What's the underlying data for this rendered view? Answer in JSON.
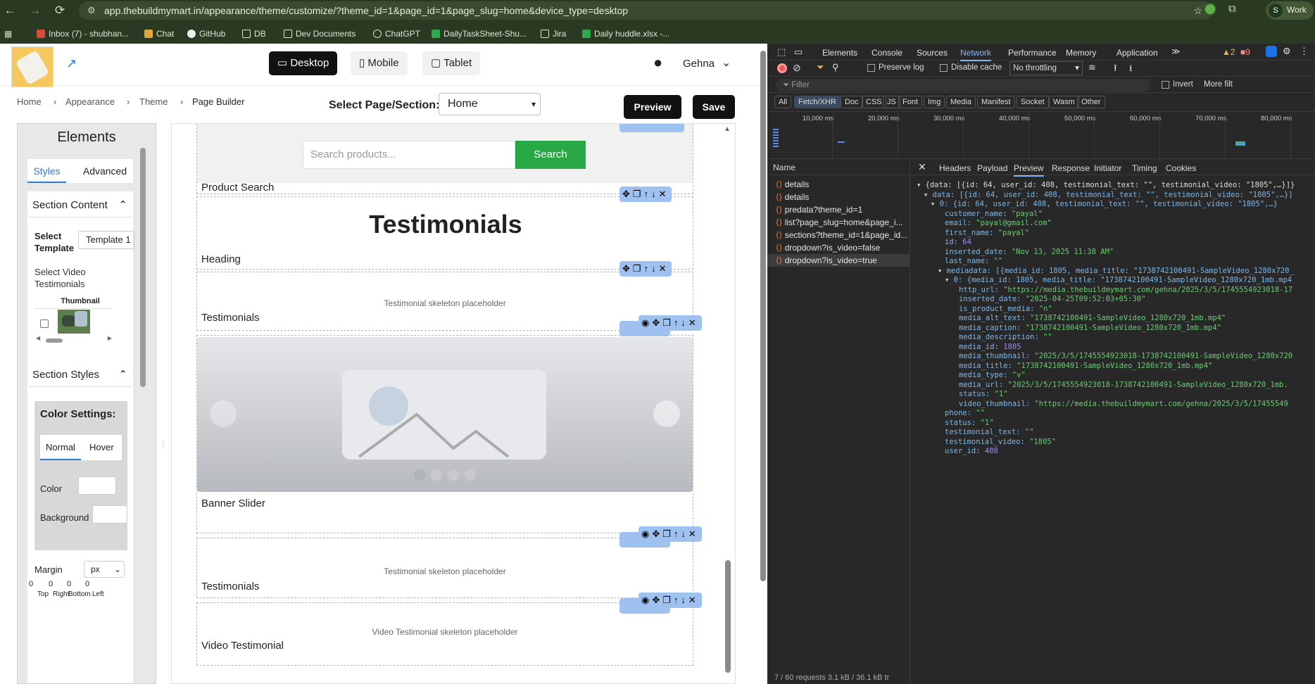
{
  "browser": {
    "url": "app.thebuildmymart.in/appearance/theme/customize/?theme_id=1&page_id=1&page_slug=home&device_type=desktop",
    "profile_initial": "S",
    "profile_label": "Work",
    "bookmarks": [
      "Inbox (7) - shubhan...",
      "Chat",
      "GitHub",
      "DB",
      "Dev Documents",
      "ChatGPT",
      "DailyTaskSheet-Shu...",
      "Jira",
      "Daily huddle.xlsx -..."
    ]
  },
  "app": {
    "devices": [
      "Desktop",
      "Mobile",
      "Tablet"
    ],
    "active_device": "Desktop",
    "user_name": "Gehna",
    "breadcrumb": [
      "Home",
      "Appearance",
      "Theme",
      "Page Builder"
    ],
    "select_page_label": "Select Page/Section:",
    "select_page_value": "Home",
    "preview_label": "Preview",
    "save_label": "Save"
  },
  "sidebar": {
    "title": "Elements",
    "tabs": [
      "Styles",
      "Advanced"
    ],
    "section_content": "Section Content",
    "select_template_label": "Select Template",
    "template_value": "Template 1",
    "select_video_label": "Select Video Testimonials",
    "thumbnail_header": "Thumbnail",
    "section_styles": "Section Styles",
    "color_settings": "Color Settings:",
    "state_tabs": [
      "Normal",
      "Hover"
    ],
    "color_label": "Color",
    "background_label": "Background",
    "margin_label": "Margin",
    "margin_unit": "px",
    "margin_values": [
      "0",
      "0",
      "0",
      "0"
    ],
    "margin_sides": [
      "Top",
      "Right",
      "Bottom",
      "Left"
    ]
  },
  "canvas": {
    "search_placeholder": "Search products...",
    "search_button": "Search",
    "sections": [
      {
        "label": "Product Search"
      },
      {
        "label": "Heading",
        "heading_text": "Testimonials"
      },
      {
        "label": "Testimonials",
        "placeholder": "Testimonial skeleton placeholder"
      },
      {
        "label": "Banner Slider"
      },
      {
        "label": "Testimonials",
        "placeholder": "Testimonial skeleton placeholder"
      },
      {
        "label": "Video Testimonial",
        "placeholder": "Video Testimonial skeleton placeholder"
      }
    ]
  },
  "devtools": {
    "tabs": [
      "Elements",
      "Console",
      "Sources",
      "Network",
      "Performance",
      "Memory",
      "Application"
    ],
    "active_tab": "Network",
    "warn_count": "2",
    "error_count": "9",
    "preserve_log": "Preserve log",
    "disable_cache": "Disable cache",
    "throttling": "No throttling",
    "filter_placeholder": "Filter",
    "invert": "Invert",
    "more_filters": "More filt",
    "type_filters": [
      "All",
      "Fetch/XHR",
      "Doc",
      "CSS",
      "JS",
      "Font",
      "Img",
      "Media",
      "Manifest",
      "Socket",
      "Wasm",
      "Other"
    ],
    "timeline_ticks": [
      "10,000 ms",
      "20,000 ms",
      "30,000 ms",
      "40,000 ms",
      "50,000 ms",
      "60,000 ms",
      "70,000 ms",
      "80,000 ms"
    ],
    "name_header": "Name",
    "requests": [
      "details",
      "details",
      "predata?theme_id=1",
      "list?page_slug=home&page_i...",
      "sections?theme_id=1&page_id...",
      "dropdown?is_video=false",
      "dropdown?is_video=true"
    ],
    "detail_tabs": [
      "Headers",
      "Payload",
      "Preview",
      "Response",
      "Initiator",
      "Timing",
      "Cookies"
    ],
    "active_detail_tab": "Preview",
    "status_bar": "7 / 60 requests   3.1 kB / 36.1 kB tr",
    "json_lines": [
      "{data: [{id: 64, user_id: 408, testimonial_text: \"\", testimonial_video: \"1805\",…}]}",
      "data: [{id: 64, user_id: 408, testimonial_text: \"\", testimonial_video: \"1805\",…}]",
      "0: {id: 64, user_id: 408, testimonial_text: \"\", testimonial_video: \"1805\",…}",
      "customer_name: \"payal\"",
      "email: \"payal@gmail.com\"",
      "first_name: \"payal\"",
      "id: 64",
      "inserted_date: \"Nov 13, 2025 11:38 AM\"",
      "last_name: \"\"",
      "mediadata: [{media_id: 1805, media_title: \"1738742100491-SampleVideo_1280x720_",
      "0: {media_id: 1805, media_title: \"1738742100491-SampleVideo_1280x720_1mb.mp4",
      "http_url: \"https://media.thebuildmymart.com/gehna/2025/3/5/1745554923018-17",
      "inserted_date: \"2025-04-25T09:52:03+05:30\"",
      "is_product_media: \"n\"",
      "media_alt_text: \"1738742100491-SampleVideo_1280x720_1mb.mp4\"",
      "media_caption: \"1738742100491-SampleVideo_1280x720_1mb.mp4\"",
      "media_description: \"\"",
      "media_id: 1805",
      "media_thumbnail: \"2025/3/5/1745554923018-1738742100491-SampleVideo_1280x720",
      "media_title: \"1738742100491-SampleVideo_1280x720_1mb.mp4\"",
      "media_type: \"v\"",
      "media_url: \"2025/3/5/1745554923018-1738742100491-SampleVideo_1280x720_1mb.",
      "status: \"1\"",
      "video_thumbnail: \"https://media.thebuildmymart.com/gehna/2025/3/5/17455549",
      "phone: \"\"",
      "status: \"1\"",
      "testimonial_text: \"\"",
      "testimonial_video: \"1805\"",
      "user_id: 408"
    ]
  }
}
